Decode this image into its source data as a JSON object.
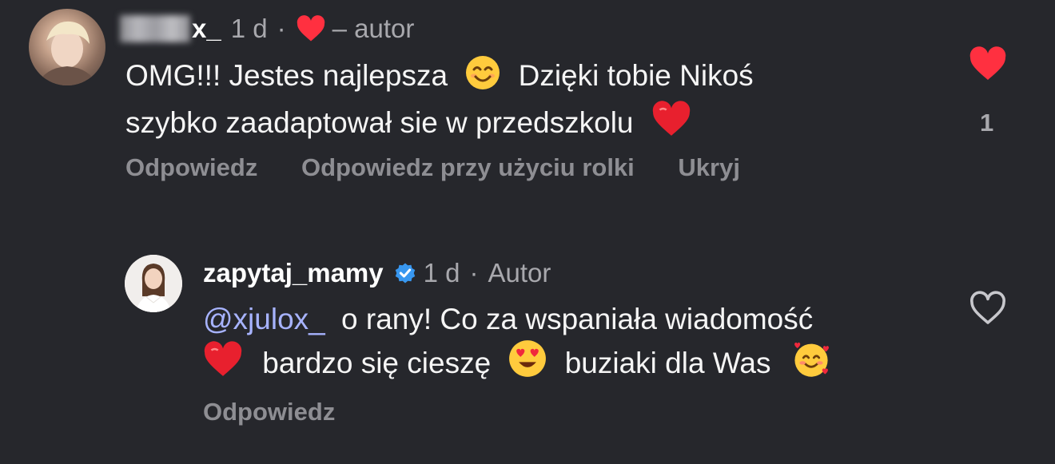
{
  "comments": [
    {
      "username_suffix": "x_",
      "time": "1 d",
      "dot": "·",
      "author_tag": "– autor",
      "text_line1": "OMG!!! Jestes najlepsza",
      "text_line1b": "Dzięki tobie Nikoś",
      "text_line2": "szybko zaadaptował sie w przedszkolu",
      "like_count": "1",
      "liked": true,
      "actions": [
        "Odpowiedz",
        "Odpowiedz przy użyciu rolki",
        "Ukryj"
      ]
    },
    {
      "username": "zapytaj_mamy",
      "verified": true,
      "time": "1 d",
      "dot": "·",
      "author_tag": "Autor",
      "mention": "@xjulox_",
      "text_line1": "o rany! Co za wspaniała wiadomość",
      "text_line2a": "bardzo się cieszę",
      "text_line2b": "buziaki dla Was",
      "liked": false,
      "actions": [
        "Odpowiedz"
      ]
    }
  ],
  "colors": {
    "background": "#26272c",
    "like_red": "#ff3040",
    "mention": "#a7b3ff",
    "verified_blue": "#3897f0"
  }
}
